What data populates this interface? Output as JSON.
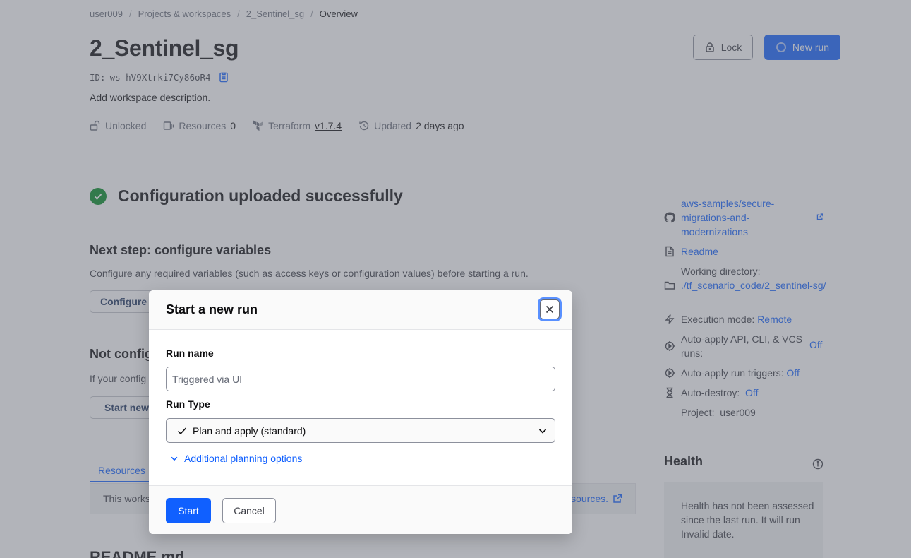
{
  "breadcrumb": {
    "items": [
      "user009",
      "Projects & workspaces",
      "2_Sentinel_sg"
    ],
    "current": "Overview"
  },
  "workspace": {
    "title": "2_Sentinel_sg",
    "id_label": "ID:",
    "id_value": "ws-hV9Xtrki7Cy86oR4",
    "add_description": "Add workspace description.",
    "lock_label": "Lock",
    "new_run_label": "New run",
    "meta": {
      "lock_status": "Unlocked",
      "resources_label": "Resources",
      "resources_count": "0",
      "terraform_label": "Terraform",
      "terraform_version": "v1.7.4",
      "updated_label": "Updated",
      "updated_value": "2 days ago"
    }
  },
  "main": {
    "success_title": "Configuration uploaded successfully",
    "next_step_title": "Next step: configure variables",
    "next_step_desc": "Configure any required variables (such as access keys or configuration values) before starting a run.",
    "configure_button": "Configure",
    "not_config_title": "Not config",
    "not_config_desc": "If your config",
    "start_new_button": "Start new",
    "tab_resources": "Resources",
    "notice_left": "This works",
    "notice_right": "sources.",
    "readme_heading": "README.md"
  },
  "sidebar": {
    "repo": "aws-samples/secure-migrations-and-modernizations",
    "readme": "Readme",
    "working_dir_label": "Working directory:",
    "working_dir_value": "./tf_scenario_code/2_sentinel-sg/",
    "exec_mode_label": "Execution mode:",
    "exec_mode_value": "Remote",
    "auto_apply_label": "Auto-apply API, CLI, & VCS runs:",
    "auto_apply_value": "Off",
    "auto_apply_triggers_label": "Auto-apply run triggers:",
    "auto_apply_triggers_value": "Off",
    "auto_destroy_label": "Auto-destroy:",
    "auto_destroy_value": "Off",
    "project_label": "Project:",
    "project_value": "user009"
  },
  "health": {
    "title": "Health",
    "message": "Health has not been assessed since the last run. It will run Invalid date."
  },
  "modal": {
    "title": "Start a new run",
    "run_name_label": "Run name",
    "run_name_placeholder": "Triggered via UI",
    "run_type_label": "Run Type",
    "run_type_selected": "Plan and apply (standard)",
    "additional_options": "Additional planning options",
    "start_button": "Start",
    "cancel_button": "Cancel"
  },
  "colors": {
    "accent": "#1060ff",
    "success": "#008a22",
    "overlay": "#656a76"
  }
}
